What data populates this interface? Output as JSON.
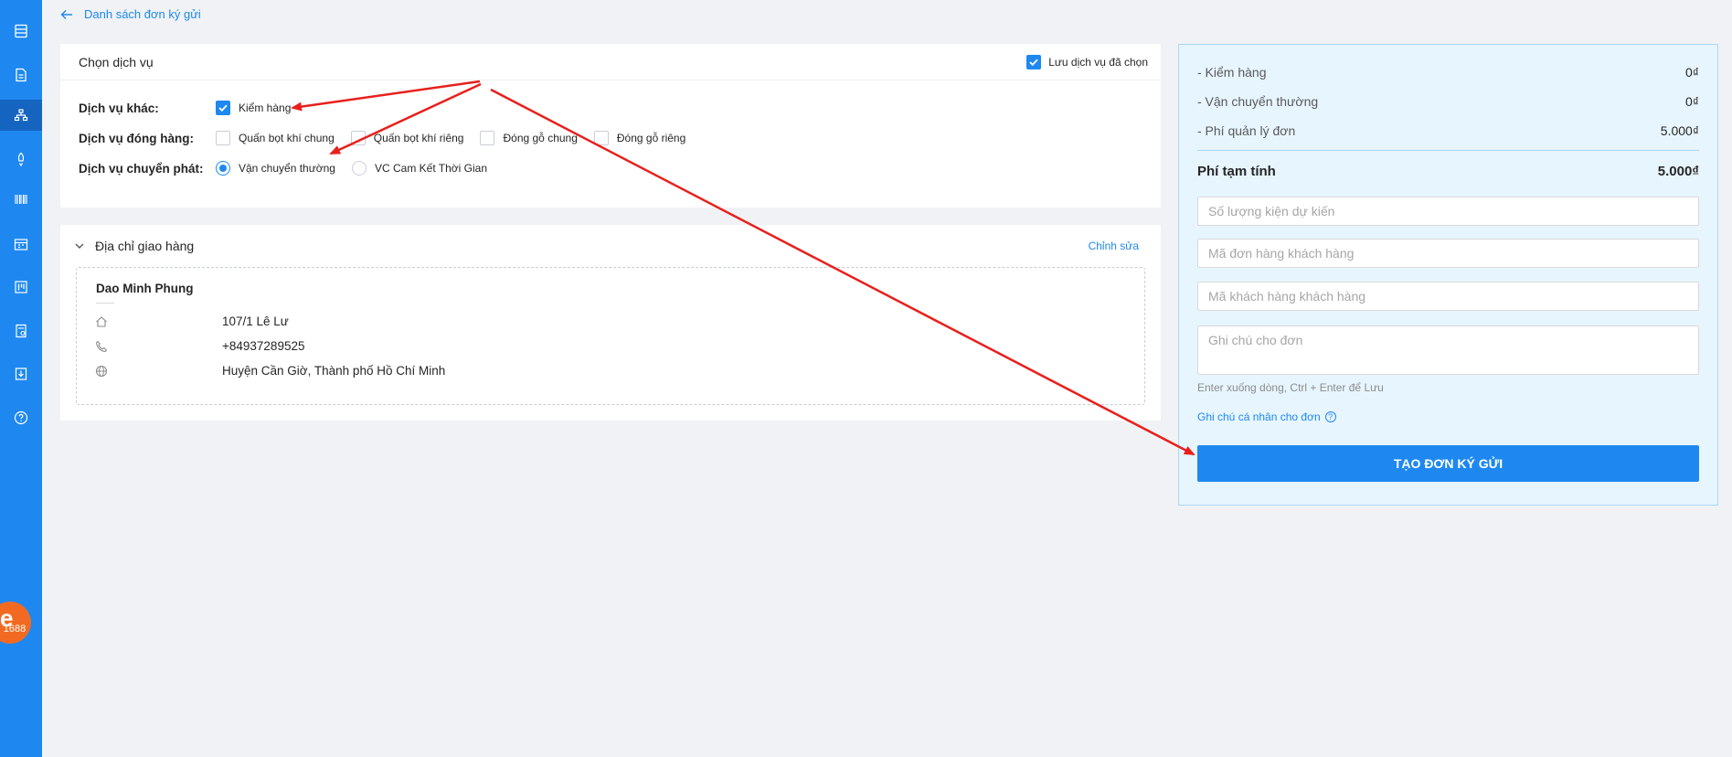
{
  "breadcrumb": {
    "label": "Danh sách đơn ký gửi"
  },
  "sidebar": {
    "items": [
      "list-icon",
      "document-icon",
      "sitemap-icon",
      "rocket-icon",
      "barcode-icon",
      "calendar-icon",
      "board-icon",
      "report-icon",
      "download-icon",
      "help-icon"
    ],
    "active_index": 2,
    "logo_text": "1688"
  },
  "service": {
    "title": "Chọn dịch vụ",
    "save_label": "Lưu dịch vụ đã chọn",
    "save_checked": true,
    "other": {
      "label": "Dịch vụ khác:",
      "options": [
        {
          "label": "Kiểm hàng",
          "checked": true
        }
      ]
    },
    "packing": {
      "label": "Dịch vụ đóng hàng:",
      "options": [
        {
          "label": "Quấn bọt khí chung",
          "checked": false
        },
        {
          "label": "Quấn bọt khí riêng",
          "checked": false
        },
        {
          "label": "Đóng gỗ chung",
          "checked": false
        },
        {
          "label": "Đóng gỗ riêng",
          "checked": false
        }
      ]
    },
    "delivery": {
      "label": "Dịch vụ chuyển phát:",
      "options": [
        {
          "label": "Vận chuyển thường",
          "selected": true
        },
        {
          "label": "VC Cam Kết Thời Gian",
          "selected": false
        }
      ]
    }
  },
  "address": {
    "title": "Địa chỉ giao hàng",
    "edit_label": "Chỉnh sửa",
    "name": "Dao Minh Phung",
    "street": "107/1 Lê Lư",
    "phone": "+84937289525",
    "region": "Huyện Cần Giờ, Thành phố Hồ Chí Minh"
  },
  "summary": {
    "fees": [
      {
        "label": "- Kiểm hàng",
        "value": "0₫"
      },
      {
        "label": "- Vận chuyển thường",
        "value": "0₫"
      },
      {
        "label": "- Phí quản lý đơn",
        "value": "5.000₫"
      }
    ],
    "total_label": "Phí tạm tính",
    "total_value": "5.000₫",
    "package_count_placeholder": "Số lượng kiện dự kiến",
    "order_code_placeholder": "Mã đơn hàng khách hàng",
    "customer_code_placeholder": "Mã khách hàng khách hàng",
    "note_placeholder": "Ghi chú cho đơn",
    "hint": "Enter xuống dòng, Ctrl + Enter để Lưu",
    "personal_note_label": "Ghi chú cá nhân cho đơn",
    "submit_label": "TẠO ĐƠN KÝ GỬI"
  },
  "colors": {
    "primary": "#1e88f0",
    "sidebar_active": "#1564c0",
    "panel_bg": "#e7f5fe",
    "annotation": "#e8201c"
  }
}
